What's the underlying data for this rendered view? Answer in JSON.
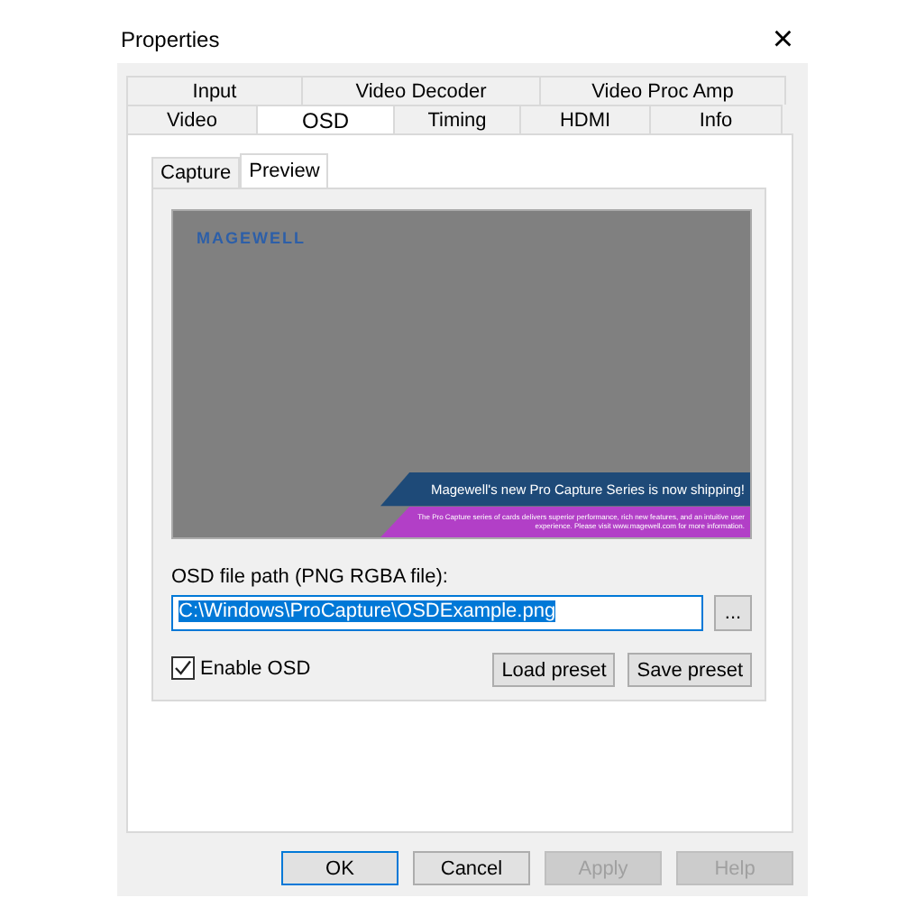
{
  "window": {
    "title": "Properties",
    "close": "×"
  },
  "tab_rows": [
    [
      {
        "label": "Input",
        "selected": false
      },
      {
        "label": "Video Decoder",
        "selected": false
      },
      {
        "label": "Video Proc Amp",
        "selected": false
      }
    ],
    [
      {
        "label": "Video",
        "selected": false
      },
      {
        "label": "OSD",
        "selected": true
      },
      {
        "label": "Timing",
        "selected": false
      },
      {
        "label": "HDMI",
        "selected": false
      },
      {
        "label": "Info",
        "selected": false
      }
    ]
  ],
  "subtabs": [
    {
      "label": "Capture",
      "selected": false
    },
    {
      "label": "Preview",
      "selected": true
    }
  ],
  "preview": {
    "logo": "MAGEWELL",
    "headline": "Magewell's new Pro Capture Series is now shipping!",
    "body": "The Pro Capture series of cards delivers superior performance, rich new features, and an intuitive user experience. Please visit www.magewell.com for more information."
  },
  "file_path": {
    "label": "OSD file path (PNG RGBA file):",
    "value": "C:\\Windows\\ProCapture\\OSDExample.png",
    "browse": "..."
  },
  "enable_osd": {
    "label": "Enable OSD",
    "checked": true
  },
  "preset_buttons": [
    "Load preset",
    "Save preset"
  ],
  "buttons": [
    {
      "label": "OK",
      "disabled": false,
      "default": true
    },
    {
      "label": "Cancel",
      "disabled": false,
      "default": false
    },
    {
      "label": "Apply",
      "disabled": true,
      "default": false
    },
    {
      "label": "Help",
      "disabled": true,
      "default": false
    }
  ]
}
